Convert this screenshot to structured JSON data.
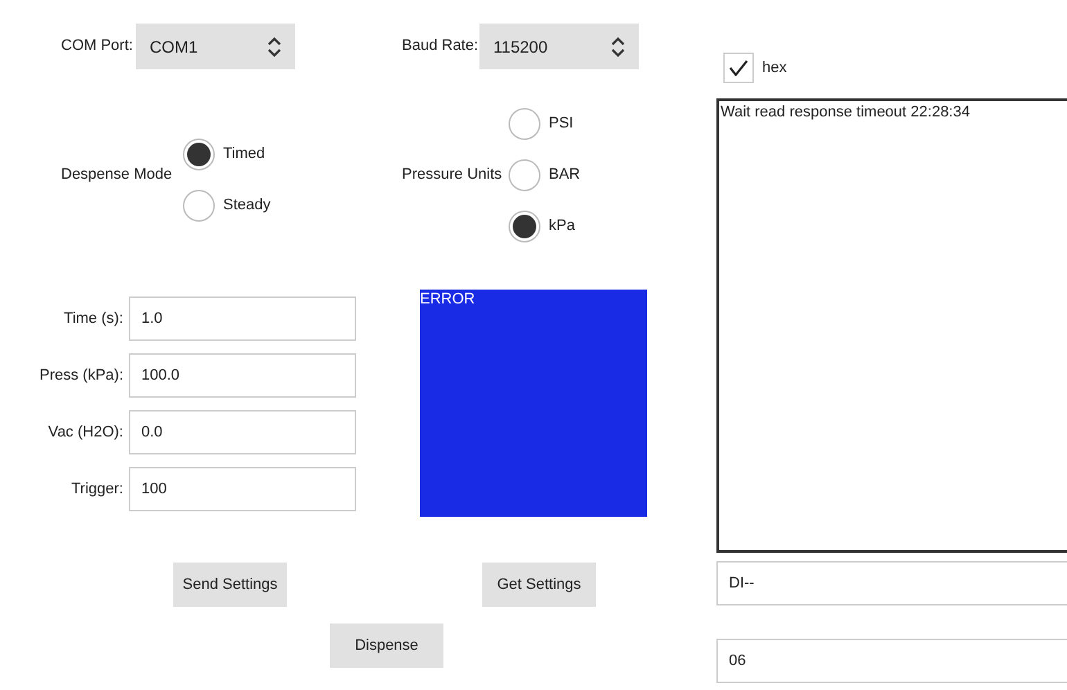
{
  "com_port": {
    "label": "COM Port:",
    "value": "COM1"
  },
  "baud_rate": {
    "label": "Baud Rate:",
    "value": "115200"
  },
  "dispense_mode": {
    "label": "Despense Mode",
    "options": [
      {
        "label": "Timed",
        "selected": true
      },
      {
        "label": "Steady",
        "selected": false
      }
    ]
  },
  "pressure_units": {
    "label": "Pressure Units",
    "options": [
      {
        "label": "PSI",
        "selected": false
      },
      {
        "label": "BAR",
        "selected": false
      },
      {
        "label": "kPa",
        "selected": true
      }
    ]
  },
  "fields": [
    {
      "label": "Time (s):",
      "value": "1.0"
    },
    {
      "label": "Press (kPa):",
      "value": "100.0"
    },
    {
      "label": "Vac (H2O):",
      "value": "0.0"
    },
    {
      "label": "Trigger:",
      "value": "100"
    }
  ],
  "status_panel": {
    "text": "ERROR",
    "color": "#1a2be6"
  },
  "buttons": {
    "send": "Send Settings",
    "get": "Get Settings",
    "dispense": "Dispense"
  },
  "hex": {
    "label": "hex",
    "checked": true
  },
  "log": {
    "lines": [
      "Wait read response timeout 22:28:34"
    ]
  },
  "output_fields": [
    "DI--",
    "06"
  ]
}
